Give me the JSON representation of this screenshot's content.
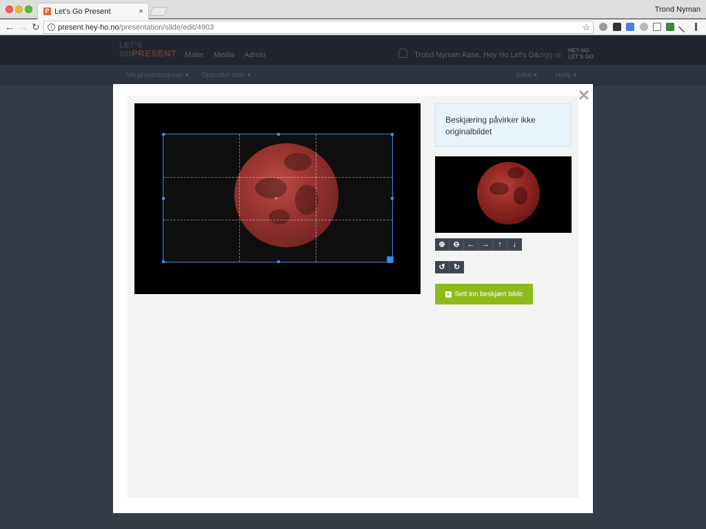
{
  "browser": {
    "tab_title": "Let's Go Present",
    "favicon_letter": "P",
    "tab_close": "×",
    "profile_name": "Trond Nyman",
    "url_domain": "present.hey-ho.no",
    "url_path": "/presentation/slide/edit/4903"
  },
  "app_header": {
    "logo_line1": "LET'S",
    "logo_line2_go": "GO",
    "logo_line2_present": "PRESENT",
    "nav": [
      "Maler",
      "Media",
      "Admin"
    ],
    "user_text": "Trond Nyman Aase, Hey Ho Let's Go",
    "logout": "Logg ut",
    "brand_line1": "HEY HO",
    "brand_line2": "LET'S GO"
  },
  "subnav": {
    "filter_presentations": "Vis presentasjoner ▾",
    "filter_created": "Opprettet dato ▾",
    "search": "Søke ▾",
    "help": "Hjelp ▾"
  },
  "modal": {
    "close_glyph": "✕",
    "info_text": "Beskjæring påvirker ikke originalbildet",
    "toolbar1": [
      {
        "name": "zoom-in",
        "glyph": "⊕"
      },
      {
        "name": "zoom-out",
        "glyph": "⊖"
      },
      {
        "name": "move-left",
        "glyph": "←"
      },
      {
        "name": "move-right",
        "glyph": "→"
      },
      {
        "name": "move-up",
        "glyph": "↑"
      },
      {
        "name": "move-down",
        "glyph": "↓"
      }
    ],
    "toolbar2": [
      {
        "name": "rotate-left",
        "glyph": "↺"
      },
      {
        "name": "rotate-right",
        "glyph": "↻"
      }
    ],
    "insert_button_label": "Sett inn beskjært bilde",
    "insert_button_icon": "+",
    "crop_center_glyph": "+"
  },
  "colors": {
    "accent_green": "#8dbc1a",
    "crop_blue": "#3b8fe0",
    "info_bg": "#e9f4fa"
  }
}
